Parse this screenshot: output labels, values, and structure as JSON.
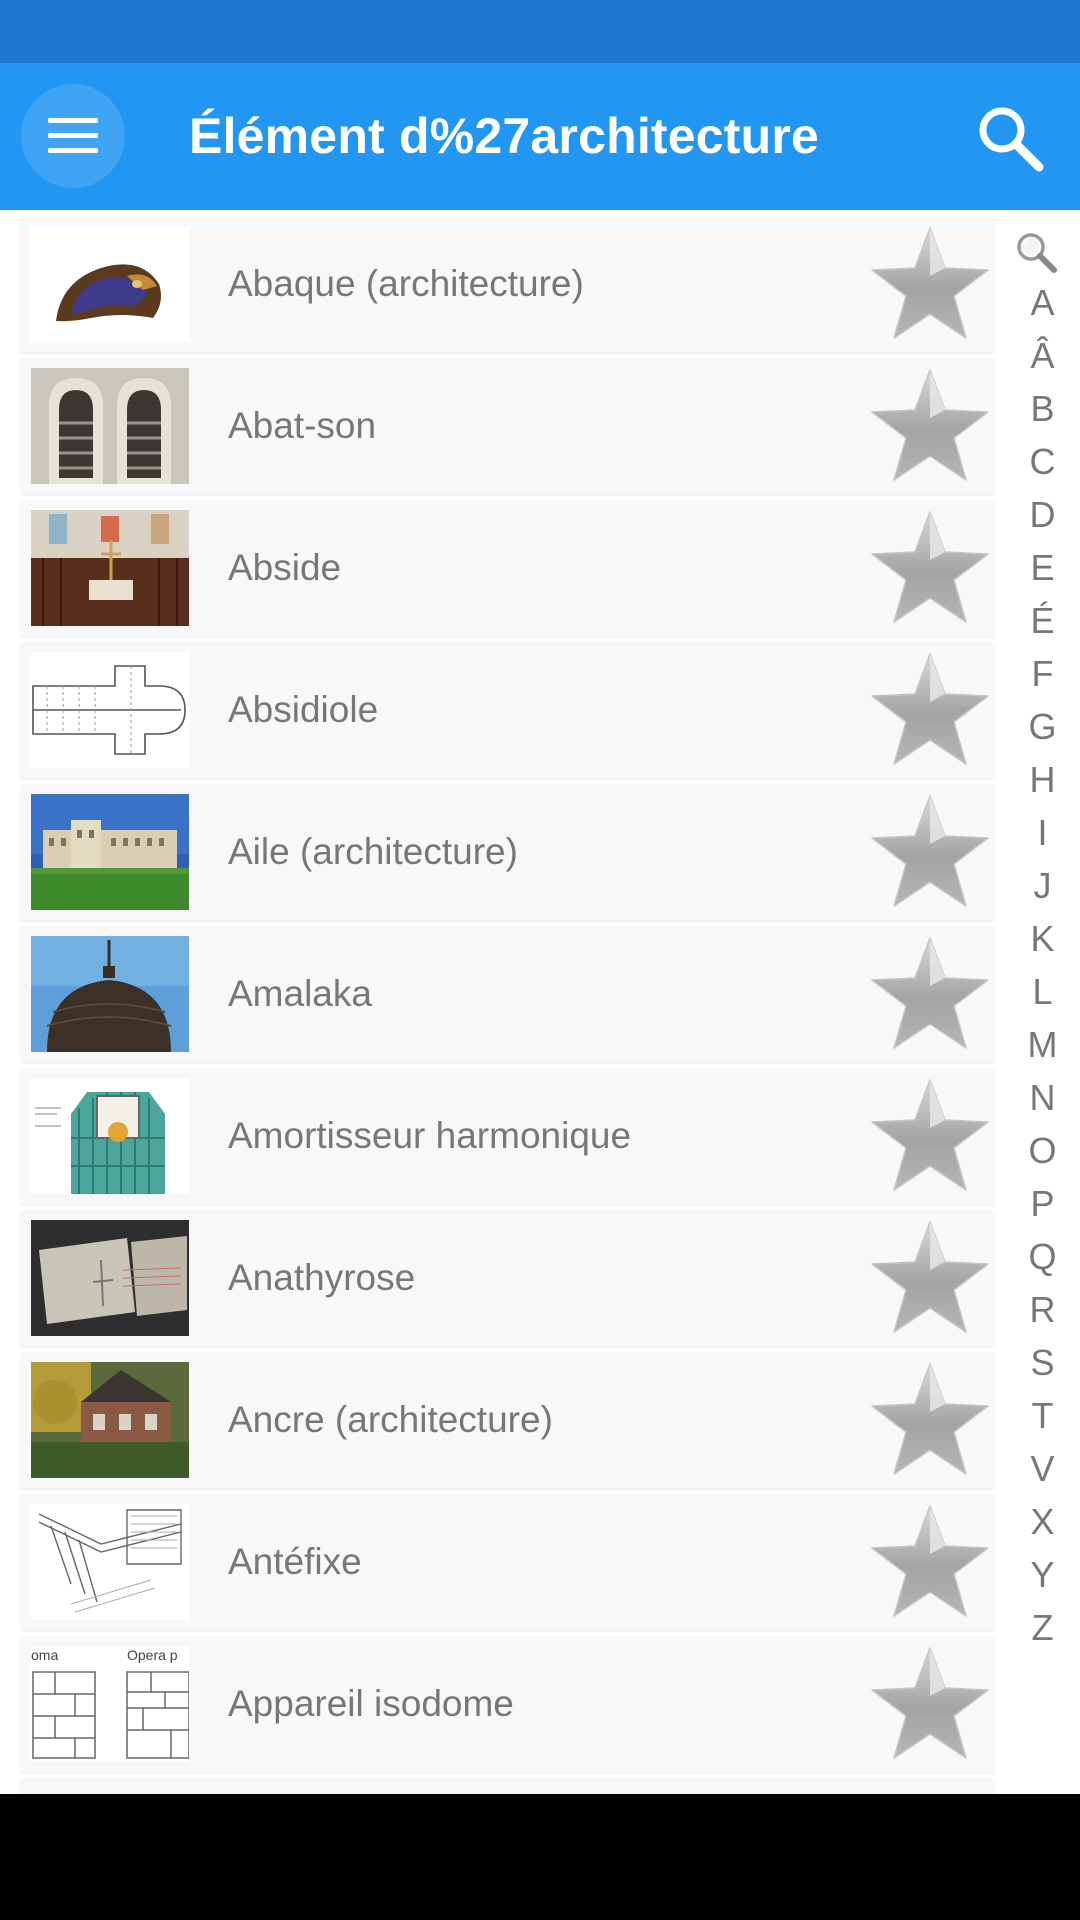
{
  "app_bar": {
    "title": "Élément d%27architecture",
    "menu_icon": "hamburger-menu-icon",
    "search_icon": "search-icon"
  },
  "colors": {
    "status_bar": "#1f77d0",
    "app_bar": "#2196f3",
    "row_background": "#f8f8f8",
    "label_text": "#777777"
  },
  "items": [
    {
      "label": "Abaque (architecture)",
      "thumb": "capital-ornament-thumbnail",
      "favorite": false
    },
    {
      "label": "Abat-son",
      "thumb": "louvred-window-thumbnail",
      "favorite": false
    },
    {
      "label": "Abside",
      "thumb": "church-apse-thumbnail",
      "favorite": false
    },
    {
      "label": "Absidiole",
      "thumb": "floor-plan-thumbnail",
      "favorite": false
    },
    {
      "label": "Aile (architecture)",
      "thumb": "palace-wing-thumbnail",
      "favorite": false
    },
    {
      "label": "Amalaka",
      "thumb": "temple-dome-thumbnail",
      "favorite": false
    },
    {
      "label": "Amortisseur harmonique",
      "thumb": "tower-damper-thumbnail",
      "favorite": false
    },
    {
      "label": "Anathyrose",
      "thumb": "stone-block-thumbnail",
      "favorite": false
    },
    {
      "label": "Ancre (architecture)",
      "thumb": "brick-house-thumbnail",
      "favorite": false
    },
    {
      "label": "Antéfixe",
      "thumb": "roof-sketch-thumbnail",
      "favorite": false
    },
    {
      "label": "Appareil isodome",
      "thumb": "masonry-diagram-thumbnail",
      "favorite": false
    }
  ],
  "thumb_texts": {
    "masonry_left": "oma",
    "masonry_right": "Opera p"
  },
  "index": {
    "search_icon": "magnifier-icon",
    "letters": [
      "A",
      "Â",
      "B",
      "C",
      "D",
      "E",
      "É",
      "F",
      "G",
      "H",
      "I",
      "J",
      "K",
      "L",
      "M",
      "N",
      "O",
      "P",
      "Q",
      "R",
      "S",
      "T",
      "V",
      "X",
      "Y",
      "Z"
    ]
  }
}
